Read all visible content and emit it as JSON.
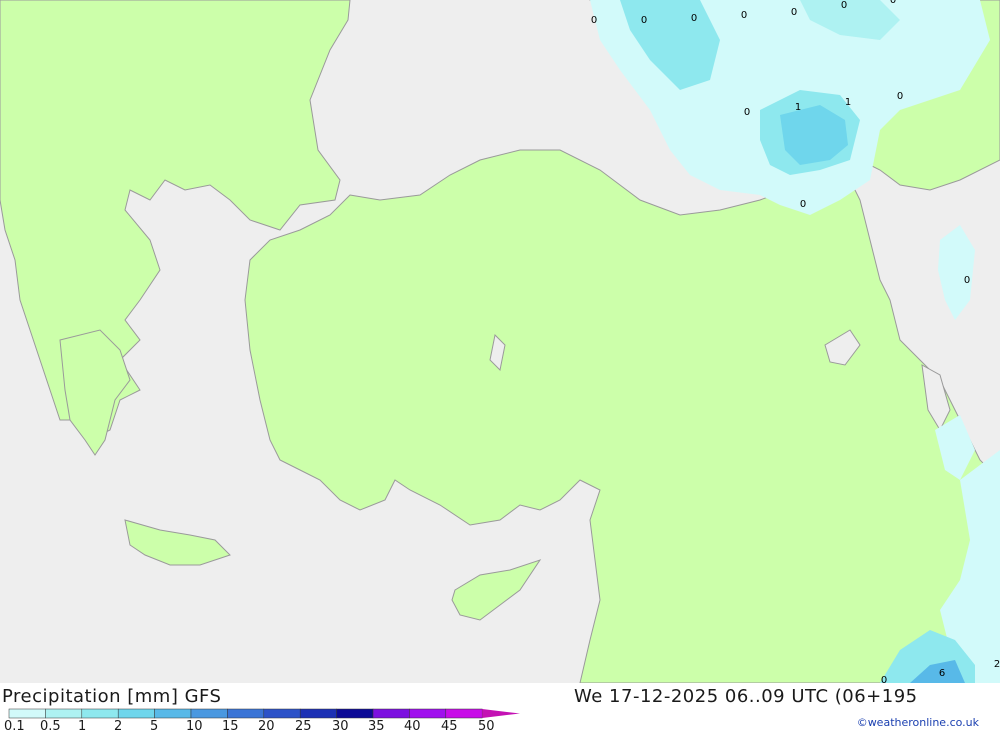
{
  "title": "Precipitation [mm] GFS",
  "datetime": "We 17-12-2025 06..09 UTC (06+195",
  "credit": "©weatheronline.co.uk",
  "legend": {
    "colors": [
      "#d2fafa",
      "#aef2f2",
      "#8ee8ee",
      "#6fd6ec",
      "#58b9e8",
      "#4a98e0",
      "#3a74d6",
      "#2c52c8",
      "#1c30b4",
      "#0c0a96",
      "#7c10e0",
      "#a010ee",
      "#c80ce8",
      "#ea10e0",
      "#c412b4",
      "#a0129a"
    ],
    "labels": [
      "0.1",
      "0.5",
      "1",
      "2",
      "5",
      "10",
      "15",
      "20",
      "25",
      "30",
      "35",
      "40",
      "45",
      "50"
    ]
  },
  "map_values": [
    "0",
    "0",
    "0",
    "0",
    "0",
    "0",
    "0",
    "0",
    "1",
    "1",
    "0",
    "0",
    "0",
    "6",
    "2",
    "0"
  ],
  "colors": {
    "land": "#ccffaa",
    "sea": "#eeeeee",
    "border": "#9a9a9a"
  }
}
